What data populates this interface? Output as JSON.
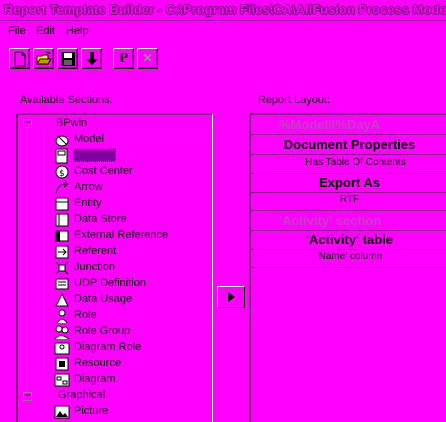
{
  "window": {
    "title": "Report Template Builder - C:\\Program Files\\CA\\AllFusion Process Modeler"
  },
  "menu": {
    "items": [
      {
        "label": "File"
      },
      {
        "label": "Edit"
      },
      {
        "label": "Help"
      }
    ]
  },
  "toolbar": {
    "buttons": [
      {
        "icon": "new-document-icon"
      },
      {
        "icon": "open-folder-icon"
      },
      {
        "icon": "save-disk-icon"
      },
      {
        "icon": "download-arrow-icon"
      },
      {
        "icon": "properties-icon",
        "glyph": "P"
      },
      {
        "icon": "delete-icon",
        "glyph": "✕"
      }
    ]
  },
  "available_sections": {
    "label": "Available Sections:",
    "root": "BPwin",
    "items": [
      {
        "label": "Model",
        "icon": "model-icon"
      },
      {
        "label": "",
        "icon": "diagram-page-icon",
        "selected": true
      },
      {
        "label": "Cost Center",
        "icon": "cost-center-icon"
      },
      {
        "label": "Arrow",
        "icon": "arrow-icon"
      },
      {
        "label": "Entity",
        "icon": "entity-icon"
      },
      {
        "label": "Data Store",
        "icon": "data-store-icon"
      },
      {
        "label": "External Reference",
        "icon": "external-reference-icon"
      },
      {
        "label": "Referent",
        "icon": "referent-icon"
      },
      {
        "label": "Junction",
        "icon": "junction-icon"
      },
      {
        "label": "UDP Definition",
        "icon": "udp-definition-icon"
      },
      {
        "label": "Data Usage",
        "icon": "data-usage-icon"
      },
      {
        "label": "Role",
        "icon": "role-icon"
      },
      {
        "label": "Role Group",
        "icon": "role-group-icon"
      },
      {
        "label": "Diagram Role",
        "icon": "diagram-role-icon"
      },
      {
        "label": "Resource",
        "icon": "resource-icon"
      },
      {
        "label": "Diagram",
        "icon": "diagram-icon"
      }
    ],
    "graphical": {
      "label": "Graphical",
      "items": [
        {
          "label": "Picture",
          "icon": "picture-icon"
        }
      ]
    }
  },
  "report_layout": {
    "label": "Report Layout:",
    "rows": [
      {
        "text": "%ModelII%DayA",
        "style": "header"
      },
      {
        "text": "Document Properties",
        "style": "bold"
      },
      {
        "text": "Has Table Of Contents",
        "style": "small"
      },
      {
        "text": "Export As",
        "style": "bold"
      },
      {
        "text": "RTF",
        "style": "small"
      },
      {
        "text": "'Activity' section",
        "style": "section"
      },
      {
        "text": "'Activity' table",
        "style": "bold"
      },
      {
        "text": "'Name' column",
        "style": "small"
      }
    ]
  },
  "move_button": {
    "icon": "right-triangle-icon"
  },
  "colors": {
    "background": "#ff00ff",
    "shadow": "#7a007a",
    "faded_text": "#c040c0"
  }
}
